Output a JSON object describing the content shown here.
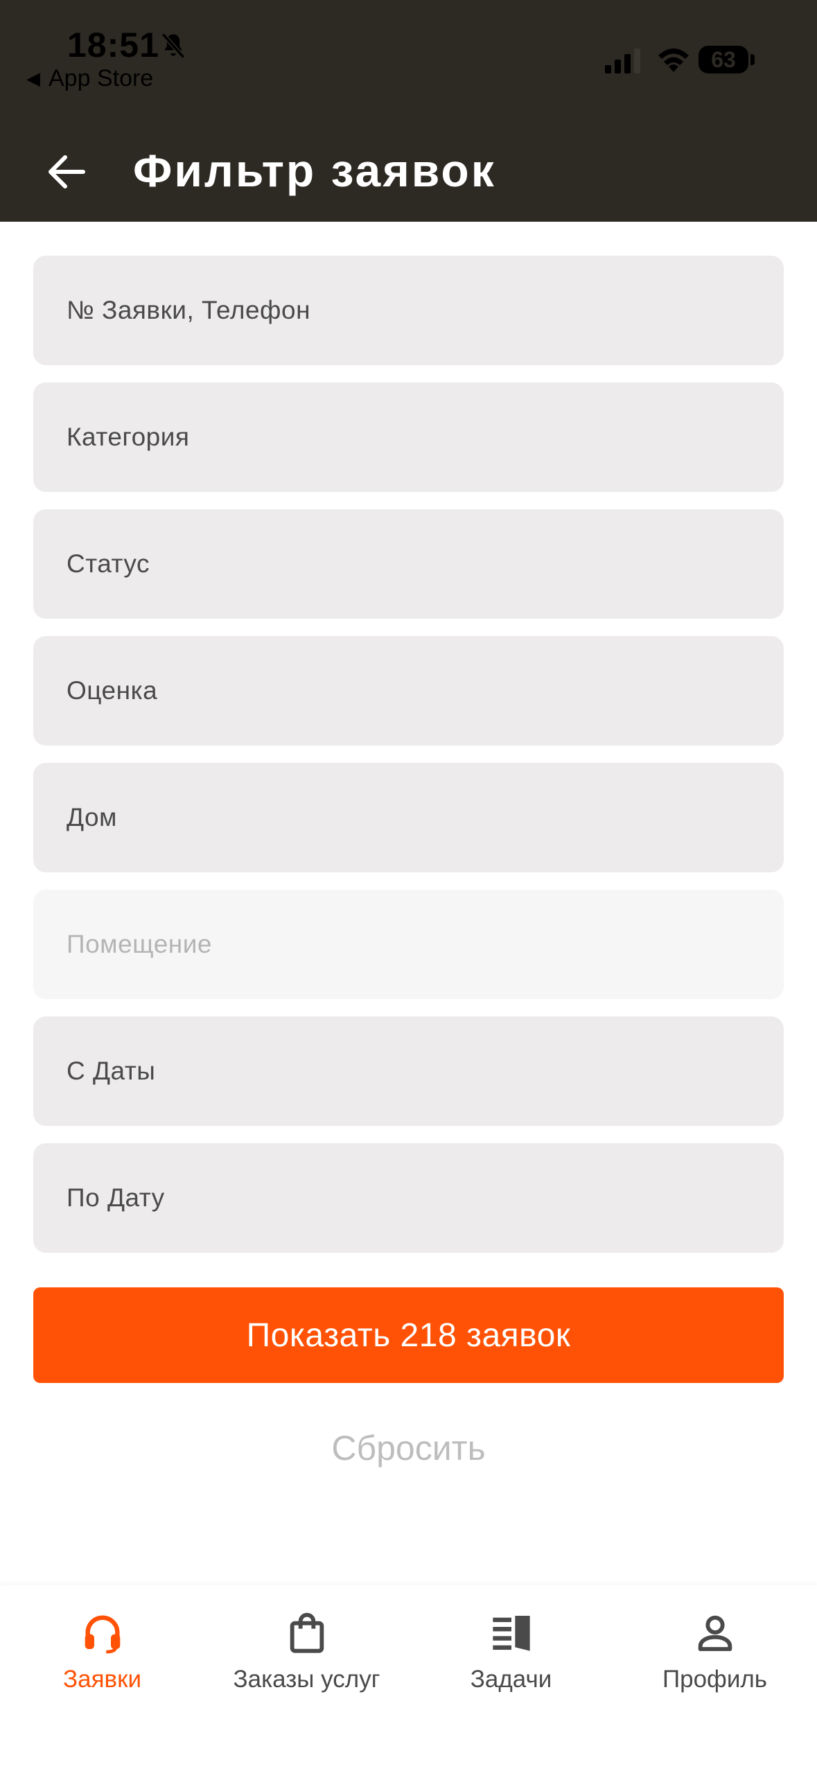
{
  "status_bar": {
    "time": "18:51",
    "back_app": "App Store",
    "battery": "63"
  },
  "header": {
    "title": "Фильтр заявок"
  },
  "fields": [
    {
      "placeholder": "№ Заявки, Телефон",
      "enabled": true
    },
    {
      "placeholder": "Категория",
      "enabled": true
    },
    {
      "placeholder": "Статус",
      "enabled": true
    },
    {
      "placeholder": "Оценка",
      "enabled": true
    },
    {
      "placeholder": "Дом",
      "enabled": true
    },
    {
      "placeholder": "Помещение",
      "enabled": false
    },
    {
      "placeholder": "С Даты",
      "enabled": true
    },
    {
      "placeholder": "По Дату",
      "enabled": true
    }
  ],
  "actions": {
    "show_label": "Показать 218 заявок",
    "reset_label": "Сбросить"
  },
  "tabbar": {
    "items": [
      {
        "label": "Заявки",
        "icon": "headset-icon",
        "active": true
      },
      {
        "label": "Заказы услуг",
        "icon": "shopping-bag-icon",
        "active": false
      },
      {
        "label": "Задачи",
        "icon": "tasks-icon",
        "active": false
      },
      {
        "label": "Профиль",
        "icon": "person-icon",
        "active": false
      }
    ]
  },
  "colors": {
    "header_bg": "#2d2a24",
    "accent": "#ff5206",
    "field_bg": "#edebeb",
    "field_disabled_bg": "#f6f6f6"
  }
}
